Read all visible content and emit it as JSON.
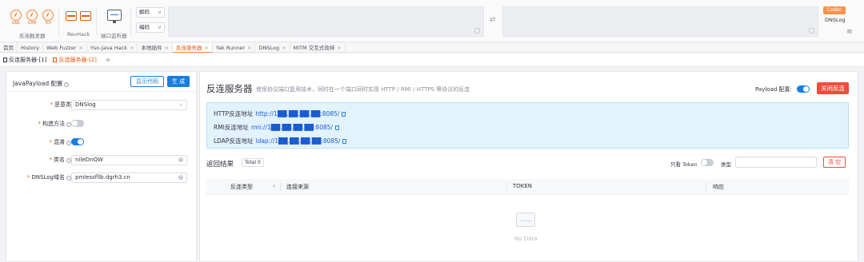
{
  "toolbar": {
    "reverse_trigger": {
      "label": "反连触发器",
      "items": [
        "DNS",
        "ICMP",
        "TCP"
      ]
    },
    "revhack": {
      "label": "RevHack"
    },
    "port_monitor": {
      "label": "端口监听器"
    },
    "decode_label": "解码",
    "encode_label": "编码",
    "codec_label": "Codec",
    "dnslog_label": "DNSLog"
  },
  "main_tabs": [
    {
      "label": "首页",
      "closable": false
    },
    {
      "label": "History",
      "closable": false
    },
    {
      "label": "Web Fuzzer",
      "closable": true
    },
    {
      "label": "Yso-Java Hack",
      "closable": true
    },
    {
      "label": "本地插件",
      "closable": true
    },
    {
      "label": "反连服务器",
      "closable": true,
      "active": true
    },
    {
      "label": "Yak Runner",
      "closable": true
    },
    {
      "label": "DNSLog",
      "closable": true
    },
    {
      "label": "MITM 交互式劫持",
      "closable": true
    }
  ],
  "sub_tabs": [
    {
      "label": "反连服务器-[1]"
    },
    {
      "label": "反连服务器-[2]",
      "active": true
    }
  ],
  "left_panel": {
    "title": "JavaPayload 配置",
    "show_code": "显示代码",
    "generate": "生 成",
    "malicious_class_label": "恶意类",
    "malicious_class_value": "DNSlog",
    "construct_method_label": "构造方法",
    "obfuscate_label": "混淆",
    "class_name_label": "类名",
    "class_name_value": "nileDnQW",
    "dnslog_domain_label": "DNSLog域名",
    "dnslog_domain_value": "pmlessfllb.dgrh3.cn",
    "construct_enabled": false,
    "obfuscate_enabled": true
  },
  "right_panel": {
    "title": "反连服务器",
    "subtitle": "使用协议端口复用技术，同时在一个端口同时实现 HTTP / RMI / HTTPS 等协议的反连",
    "payload_label": "Payload 配置:",
    "payload_enabled": true,
    "close_button": "关闭反连",
    "addresses": [
      {
        "label": "HTTP反连地址",
        "value": "http://1██.██.██.██:8085/"
      },
      {
        "label": "RMI反连地址",
        "value": "rmi://1██.██.██.██:8085/"
      },
      {
        "label": "LDAP反连地址",
        "value": "ldap://1██.██.██.██:8085/"
      }
    ],
    "results_title": "返回结果",
    "total_badge": "Total 0",
    "only_token_label": "只看 Token",
    "only_token_enabled": false,
    "type_label": "类型",
    "clear_button": "清 空",
    "columns": [
      "反连类型",
      "连接来源",
      "TOKEN",
      "响应"
    ],
    "empty_text": "No Data"
  },
  "colors": {
    "accent_orange": "#e8590c",
    "primary_blue": "#1a7de0",
    "danger_red": "#f04b3c",
    "info_bg": "#e3f3fc"
  }
}
